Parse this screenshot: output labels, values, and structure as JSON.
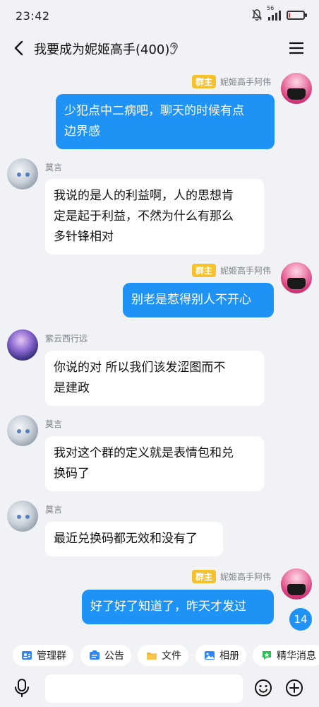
{
  "status_bar": {
    "time": "23:42",
    "network": "56",
    "battery_percent": 10,
    "battery_color": "#e53935"
  },
  "header": {
    "title": "我要成为妮姬高手(400)"
  },
  "colors": {
    "accent": "#1e92f5",
    "owner_badge": "#f5c12d",
    "background": "#f1f2f5"
  },
  "messages": [
    {
      "side": "right",
      "sender": "妮姬高手阿伟",
      "badge": "群主",
      "lines": [
        "少犯点中二病吧，聊天的时候有点",
        "边界感"
      ]
    },
    {
      "side": "left",
      "sender": "莫言",
      "lines": [
        "我说的是人的利益啊，人的思想肯",
        "定是起于利益，不然为什么有那么",
        "多针锋相对"
      ]
    },
    {
      "side": "right",
      "sender": "妮姬高手阿伟",
      "badge": "群主",
      "lines": [
        "别老是惹得别人不开心"
      ]
    },
    {
      "side": "left",
      "sender": "紫云西行远",
      "lines": [
        "你说的对 所以我们该发涩图而不",
        "是建政"
      ]
    },
    {
      "side": "left",
      "sender": "莫言",
      "lines": [
        "我对这个群的定义就是表情包和兑",
        "换码了"
      ]
    },
    {
      "side": "left",
      "sender": "莫言",
      "lines": [
        "最近兑换码都无效和没有了"
      ]
    },
    {
      "side": "right",
      "sender": "妮姬高手阿伟",
      "badge": "群主",
      "lines": [
        "好了好了知道了，昨天才发过"
      ]
    }
  ],
  "unread_count": "14",
  "quick_actions": [
    {
      "label": "管理群",
      "icon": "manage-group-icon",
      "color": "#2f86f6"
    },
    {
      "label": "公告",
      "icon": "announcement-icon",
      "color": "#2f86f6"
    },
    {
      "label": "文件",
      "icon": "folder-icon",
      "color": "#f5b52d"
    },
    {
      "label": "相册",
      "icon": "album-icon",
      "color": "#2f86f6"
    },
    {
      "label": "精华消息",
      "icon": "essence-icon",
      "color": "#2fbf5a"
    }
  ]
}
